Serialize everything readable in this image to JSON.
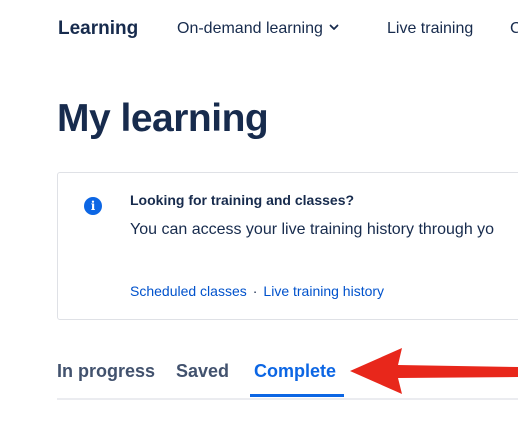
{
  "topnav": {
    "brand": "Learning",
    "items": [
      {
        "label": "On-demand learning",
        "has_dropdown": true,
        "icon": "chevron-down-icon"
      },
      {
        "label": "Live training"
      },
      {
        "label": "C"
      }
    ]
  },
  "page_title": "My learning",
  "info_panel": {
    "icon": "info-icon",
    "icon_color": "#0c66e4",
    "heading": "Looking for training and classes?",
    "body": "You can access your live training history through yo",
    "links": [
      {
        "label": "Scheduled classes"
      },
      {
        "label": "Live training history"
      }
    ],
    "separator": "·"
  },
  "tabs": {
    "items": [
      {
        "label": "In progress"
      },
      {
        "label": "Saved"
      },
      {
        "label": "Complete"
      }
    ],
    "active": "Complete",
    "active_color": "#0c66e4"
  },
  "annotation": {
    "type": "arrow",
    "color": "#e8271b",
    "points_to": "Complete"
  }
}
